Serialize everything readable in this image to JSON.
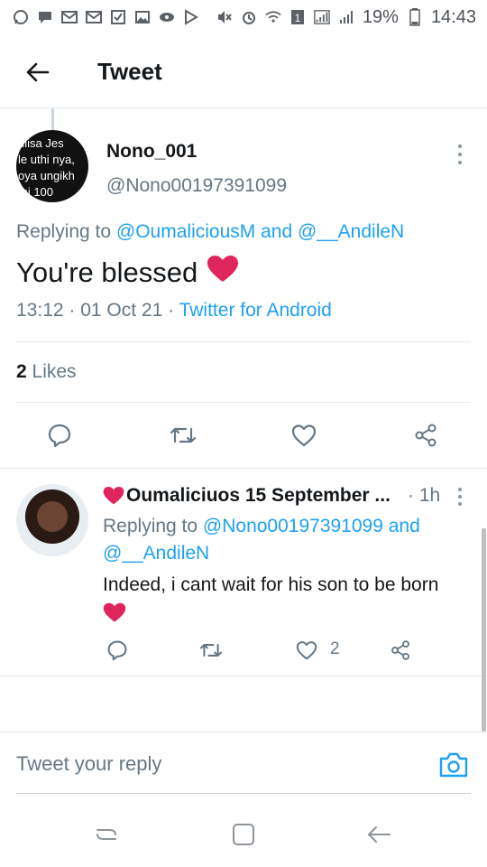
{
  "status_bar": {
    "battery_percent": "19%",
    "time": "14:43",
    "left_icons": [
      "whatsapp-icon",
      "chat-icon",
      "gmail-icon",
      "gmail-icon",
      "check-icon",
      "gallery-icon",
      "video-icon",
      "play-store-icon"
    ],
    "right_icons": [
      "mute-icon",
      "alarm-icon",
      "wifi-icon",
      "sim1-icon",
      "signal-icon",
      "signal-icon",
      "battery-icon"
    ]
  },
  "header": {
    "title": "Tweet"
  },
  "main_tweet": {
    "author_name": "Nono_001",
    "author_handle": "@Nono00197391099",
    "avatar_text": [
      "ulisa Jes",
      "le uthi nya,",
      "oya ungikh",
      "mi 100"
    ],
    "replying_prefix": "Replying to",
    "replying_user1": "@OumaliciousM",
    "replying_and": "and",
    "replying_user2": "@__AndileN",
    "text": "You're blessed",
    "time": "13:12",
    "date": "01 Oct 21",
    "client": "Twitter for Android",
    "likes_count": "2",
    "likes_label": "Likes"
  },
  "reply_tweet": {
    "author_name": "Oumaliciuos 15 September ...",
    "time": "1h",
    "replying_prefix": "Replying to",
    "replying_user1": "@Nono00197391099",
    "replying_and": "and",
    "replying_user2": "@__AndileN",
    "text": "Indeed, i cant wait for his son to be born",
    "like_count": "2"
  },
  "composer": {
    "placeholder": "Tweet your reply"
  },
  "colors": {
    "link": "#1da1f2",
    "secondary_text": "#657786",
    "heart": "#e0245e",
    "divider": "#e1e8ed"
  }
}
